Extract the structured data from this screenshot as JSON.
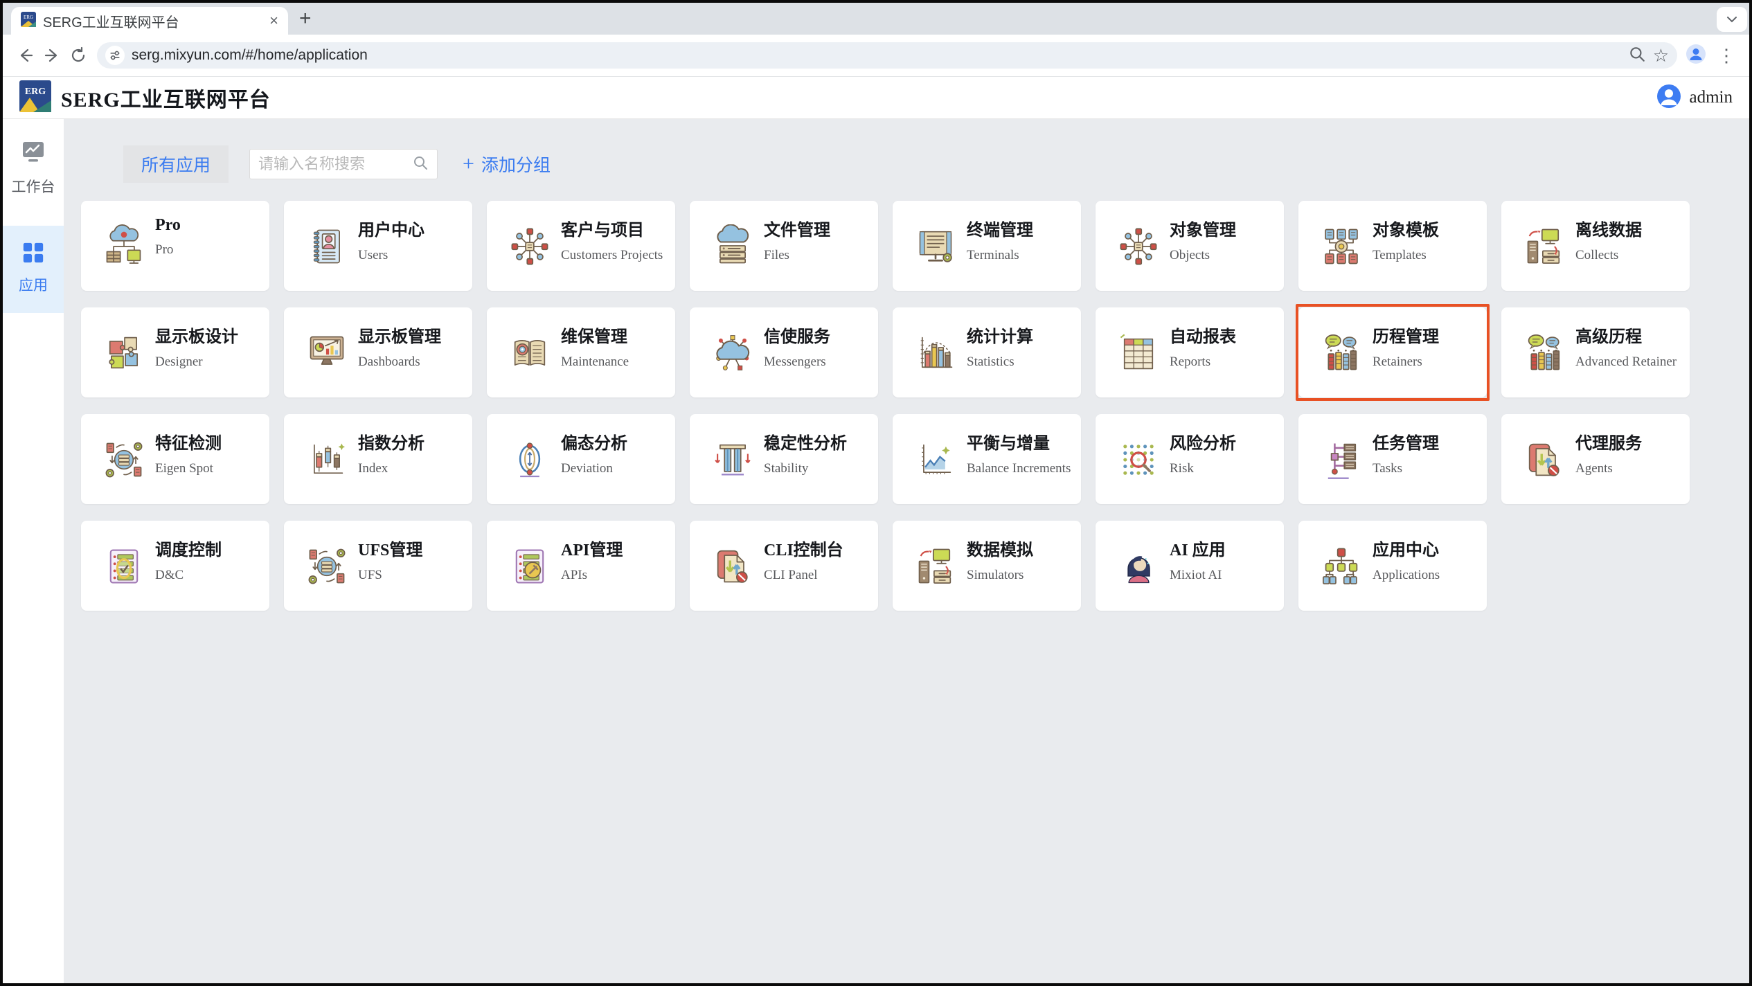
{
  "browser": {
    "tab_title": "SERG工业互联网平台",
    "url": "serg.mixyun.com/#/home/application"
  },
  "header": {
    "logo_text": "ERG",
    "title": "SERG工业互联网平台",
    "user": "admin"
  },
  "sidebar": {
    "items": [
      {
        "label": "工作台",
        "icon": "workbench",
        "active": false
      },
      {
        "label": "应用",
        "icon": "apps",
        "active": true
      }
    ]
  },
  "toolbar": {
    "all_apps_label": "所有应用",
    "search_placeholder": "请输入名称搜索",
    "add_group_label": "添加分组"
  },
  "apps": [
    {
      "title": "Pro",
      "subtitle": "Pro",
      "icon": "pro"
    },
    {
      "title": "用户中心",
      "subtitle": "Users",
      "icon": "users"
    },
    {
      "title": "客户与项目",
      "subtitle": "Customers Projects",
      "icon": "customers"
    },
    {
      "title": "文件管理",
      "subtitle": "Files",
      "icon": "files"
    },
    {
      "title": "终端管理",
      "subtitle": "Terminals",
      "icon": "terminals"
    },
    {
      "title": "对象管理",
      "subtitle": "Objects",
      "icon": "objects"
    },
    {
      "title": "对象模板",
      "subtitle": "Templates",
      "icon": "templates"
    },
    {
      "title": "离线数据",
      "subtitle": "Collects",
      "icon": "collects"
    },
    {
      "title": "显示板设计",
      "subtitle": "Designer",
      "icon": "designer"
    },
    {
      "title": "显示板管理",
      "subtitle": "Dashboards",
      "icon": "dashboards"
    },
    {
      "title": "维保管理",
      "subtitle": "Maintenance",
      "icon": "maintenance"
    },
    {
      "title": "信使服务",
      "subtitle": "Messengers",
      "icon": "messengers"
    },
    {
      "title": "统计计算",
      "subtitle": "Statistics",
      "icon": "statistics"
    },
    {
      "title": "自动报表",
      "subtitle": "Reports",
      "icon": "reports"
    },
    {
      "title": "历程管理",
      "subtitle": "Retainers",
      "icon": "retainers",
      "highlighted": true
    },
    {
      "title": "高级历程",
      "subtitle": "Advanced Retainer",
      "icon": "advanced-retainer"
    },
    {
      "title": "特征检测",
      "subtitle": "Eigen Spot",
      "icon": "eigen-spot"
    },
    {
      "title": "指数分析",
      "subtitle": "Index",
      "icon": "index"
    },
    {
      "title": "偏态分析",
      "subtitle": "Deviation",
      "icon": "deviation"
    },
    {
      "title": "稳定性分析",
      "subtitle": "Stability",
      "icon": "stability"
    },
    {
      "title": "平衡与增量",
      "subtitle": "Balance Increments",
      "icon": "balance"
    },
    {
      "title": "风险分析",
      "subtitle": "Risk",
      "icon": "risk"
    },
    {
      "title": "任务管理",
      "subtitle": "Tasks",
      "icon": "tasks"
    },
    {
      "title": "代理服务",
      "subtitle": "Agents",
      "icon": "agents"
    },
    {
      "title": "调度控制",
      "subtitle": "D&C",
      "icon": "dnc"
    },
    {
      "title": "UFS管理",
      "subtitle": "UFS",
      "icon": "ufs"
    },
    {
      "title": "API管理",
      "subtitle": "APIs",
      "icon": "apis"
    },
    {
      "title": "CLI控制台",
      "subtitle": "CLI Panel",
      "icon": "cli"
    },
    {
      "title": "数据模拟",
      "subtitle": "Simulators",
      "icon": "simulators"
    },
    {
      "title": "AI 应用",
      "subtitle": "Mixiot AI",
      "icon": "ai"
    },
    {
      "title": "应用中心",
      "subtitle": "Applications",
      "icon": "applications"
    }
  ],
  "colors": {
    "accent": "#3b7cf0",
    "highlight": "#e85124",
    "sidebar_active_bg": "#e3f0fc",
    "content_bg": "#e9ebee"
  }
}
